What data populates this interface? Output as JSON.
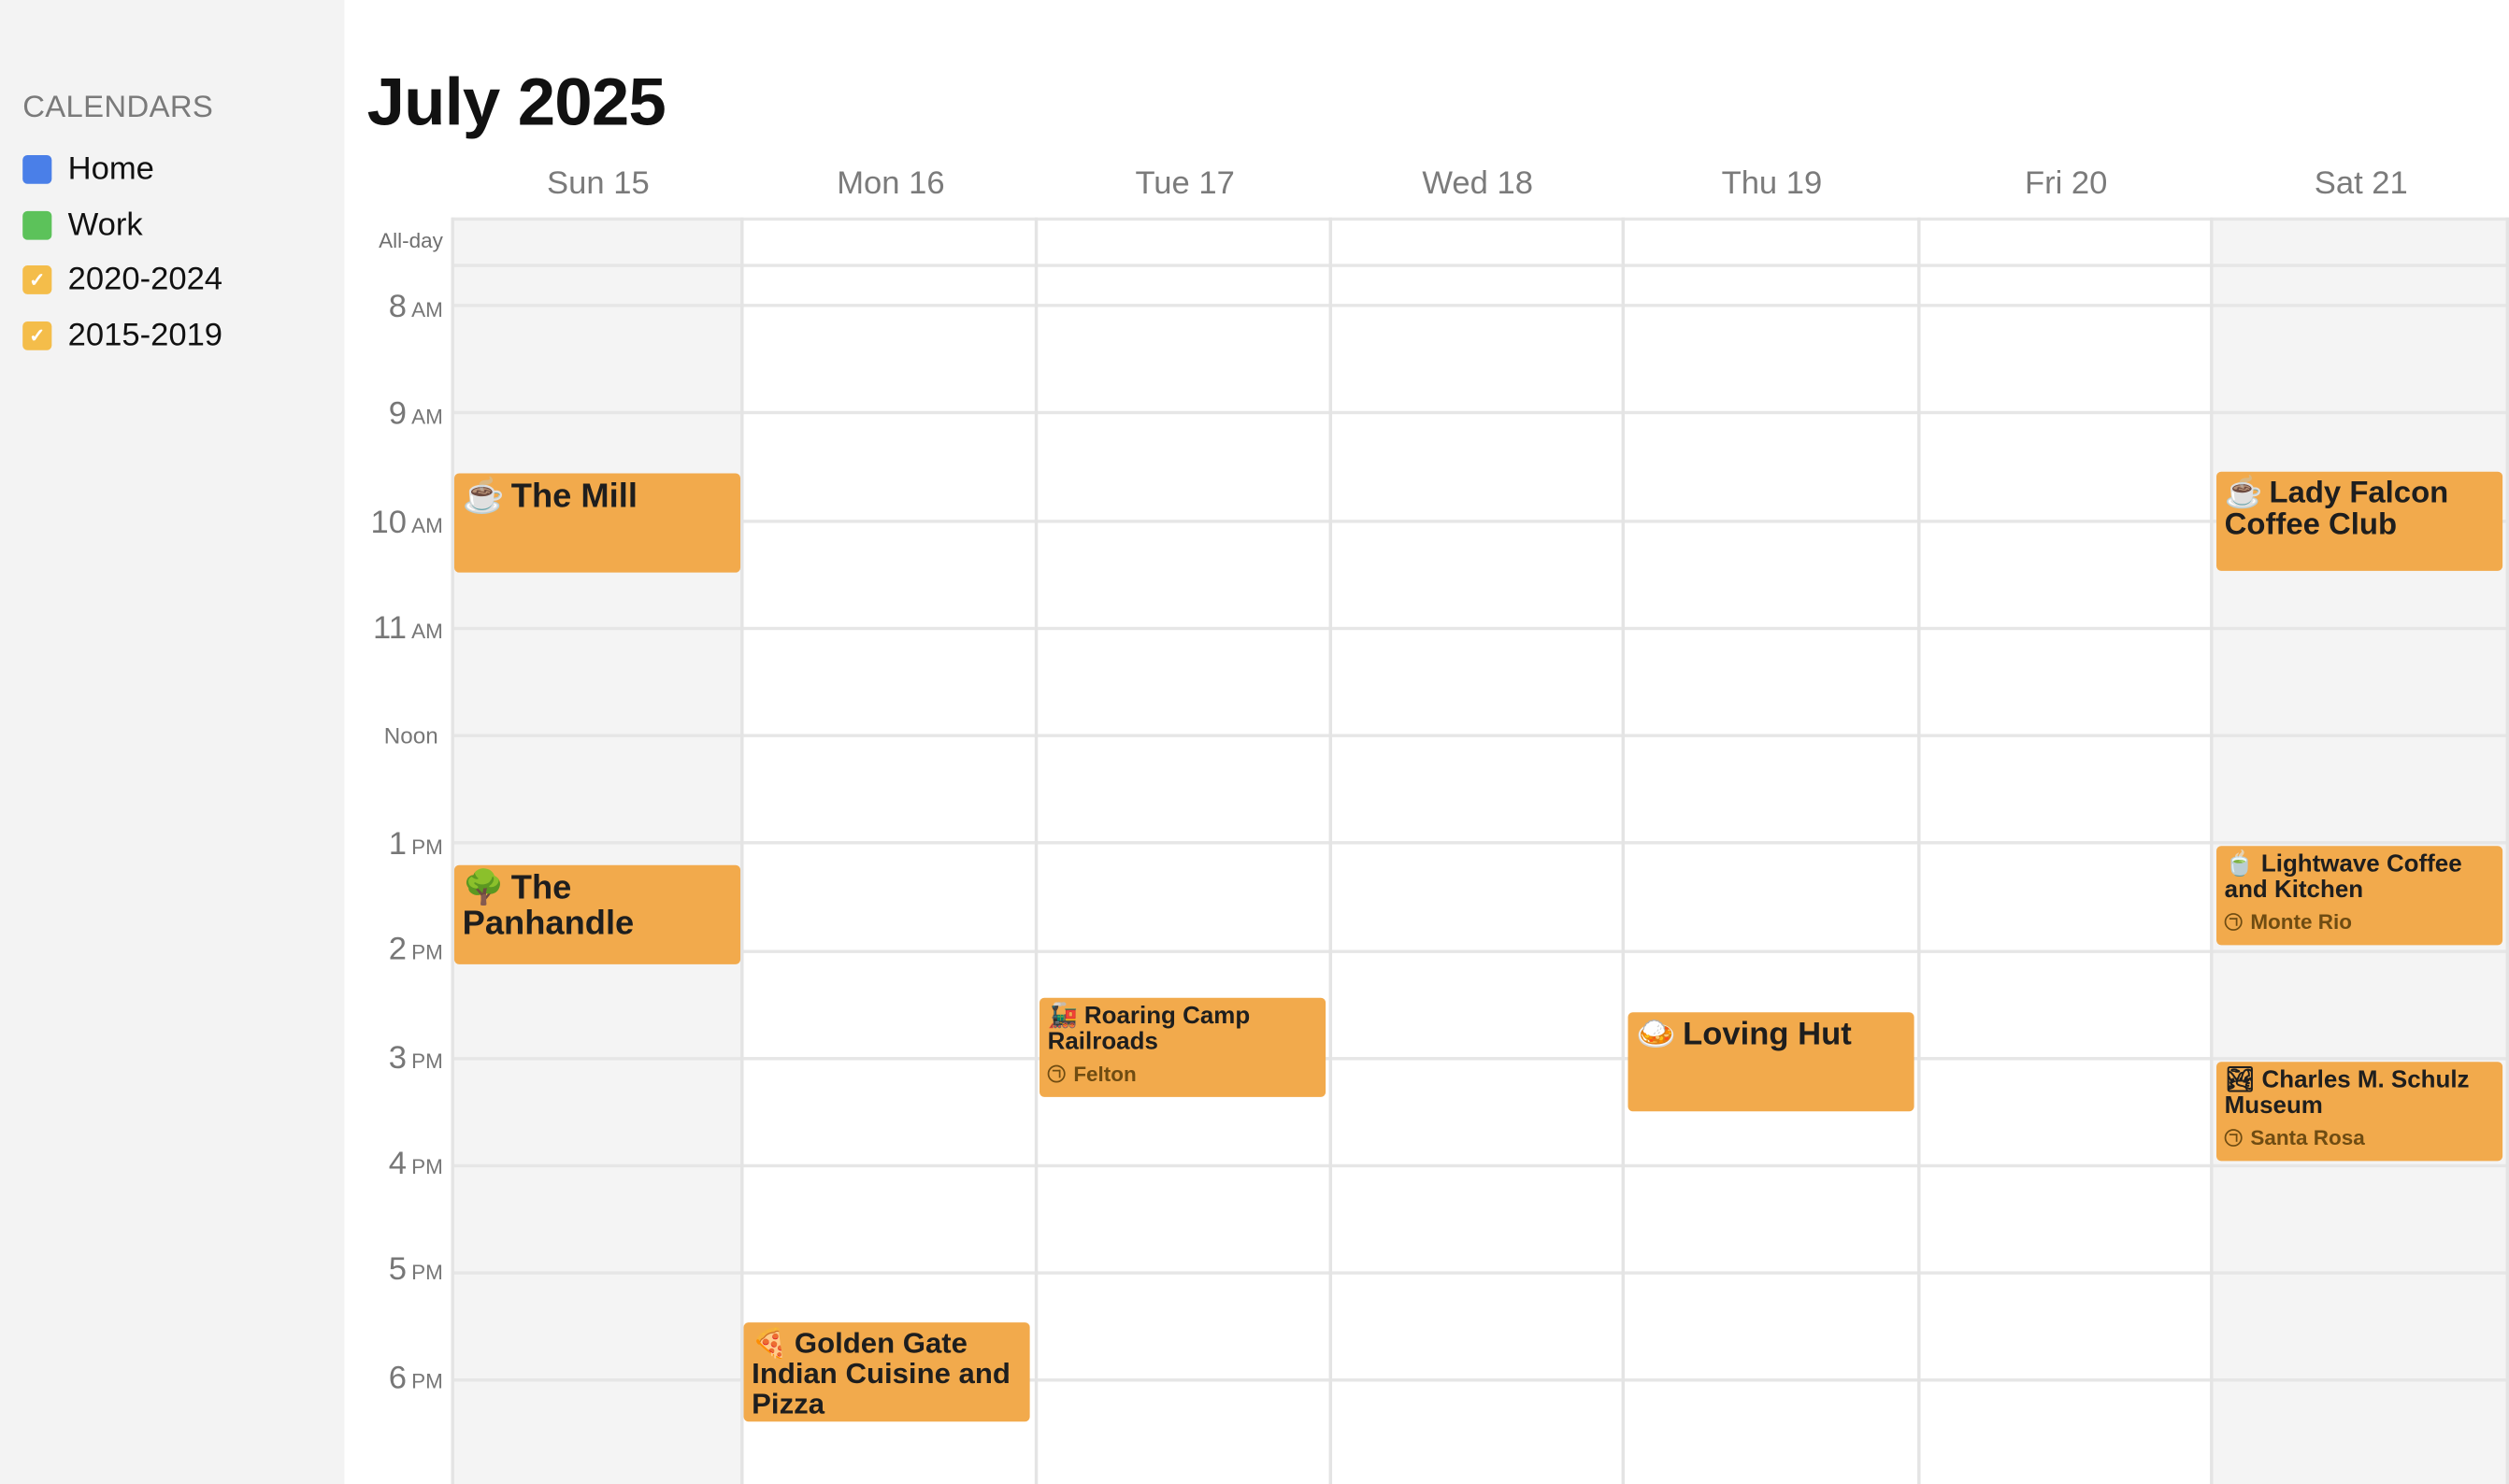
{
  "sidebar": {
    "heading": "CALENDARS",
    "calendars": [
      {
        "label": "Home",
        "color": "#4a7fe8",
        "checked": false
      },
      {
        "label": "Work",
        "color": "#5cc25a",
        "checked": false
      },
      {
        "label": "2020-2024",
        "color": "#f4bd4a",
        "checked": true,
        "check": "✓"
      },
      {
        "label": "2015-2019",
        "color": "#f4bd4a",
        "checked": true,
        "check": "✓"
      }
    ]
  },
  "header": {
    "title": "July 2025"
  },
  "days": [
    "Sun 15",
    "Mon 16",
    "Tue 17",
    "Wed 18",
    "Thu 19",
    "Fri 20",
    "Sat 21"
  ],
  "allday_label": "All-day",
  "hours": [
    {
      "num": "8",
      "ampm": "AM"
    },
    {
      "num": "9",
      "ampm": "AM"
    },
    {
      "num": "10",
      "ampm": "AM"
    },
    {
      "num": "11",
      "ampm": "AM"
    },
    {
      "num": "Noon",
      "ampm": ""
    },
    {
      "num": "1",
      "ampm": "PM"
    },
    {
      "num": "2",
      "ampm": "PM"
    },
    {
      "num": "3",
      "ampm": "PM"
    },
    {
      "num": "4",
      "ampm": "PM"
    },
    {
      "num": "5",
      "ampm": "PM"
    },
    {
      "num": "6",
      "ampm": "PM"
    }
  ],
  "event_color": "#f2aa4c",
  "events": [
    {
      "day": "Sun 15",
      "emoji": "☕",
      "title": "The Mill",
      "location": ""
    },
    {
      "day": "Sun 15",
      "emoji": "🌳",
      "title": "The Panhandle",
      "location": ""
    },
    {
      "day": "Mon 16",
      "emoji": "🍕",
      "title": "Golden Gate Indian Cuisine and Pizza",
      "location": ""
    },
    {
      "day": "Tue 17",
      "emoji": "🚂",
      "title": "Roaring Camp Railroads",
      "location": "Felton"
    },
    {
      "day": "Thu 19",
      "emoji": "🍛",
      "title": "Loving Hut",
      "location": ""
    },
    {
      "day": "Sat 21",
      "emoji": "☕",
      "title": "Lady Falcon Coffee Club",
      "location": ""
    },
    {
      "day": "Sat 21",
      "emoji": "🍵",
      "title": "Lightwave Coffee and Kitchen",
      "location": "Monte Rio"
    },
    {
      "day": "Sat 21",
      "emoji": "🏞",
      "title": "Charles M. Schulz Museum",
      "location": "Santa Rosa"
    }
  ]
}
